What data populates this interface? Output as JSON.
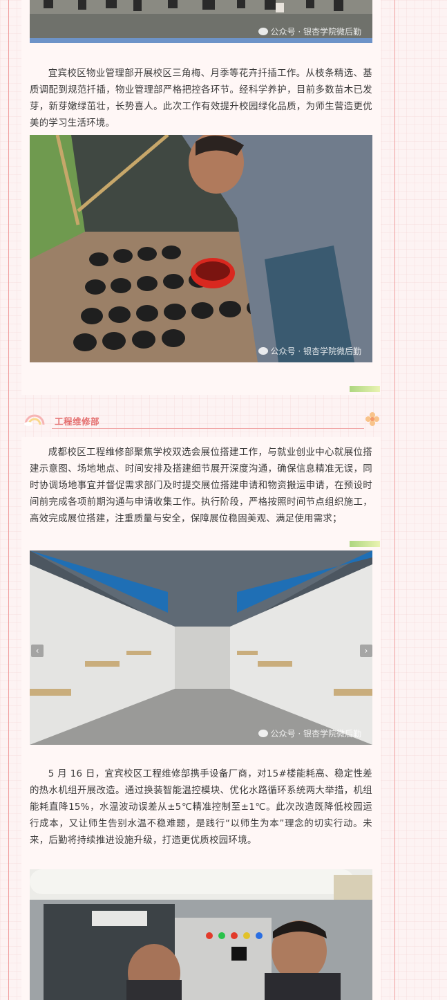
{
  "watermark": "公众号 · 银杏学院微后勤",
  "section1": {
    "paragraph": "宜宾校区物业管理部开展校区三角梅、月季等花卉扦插工作。从枝条精选、基质调配到规范扦插，物业管理部严格把控各环节。经科学养护，目前多数苗木已发芽，新芽嫩绿茁壮，长势喜人。此次工作有效提升校园绿化品质，为师生营造更优美的学习生活环境。"
  },
  "section2": {
    "title": "工程维修部",
    "paragraph1": "成都校区工程维修部聚焦学校双选会展位搭建工作，与就业创业中心就展位搭建示意图、场地地点、时间安排及搭建细节展开深度沟通，确保信息精准无误，同时协调场地事宜并督促需求部门及时提交展位搭建申请和物资搬运申请，在预设时间前完成各项前期沟通与申请收集工作。执行阶段，严格按照时间节点组织施工，高效完成展位搭建，注重质量与安全，保障展位稳固美观、满足使用需求；",
    "paragraph2": "5 月 16 日，宜宾校区工程维修部携手设备厂商，对15#楼能耗高、稳定性差的热水机组开展改造。通过换装智能温控模块、优化水路循环系统两大举措，机组能耗直降15%，水温波动误差从±5℃精准控制至±1℃。此次改造既降低校园运行成本，又让师生告别水温不稳难题，是践行“以师生为本”理念的切实行动。未来，后勤将持续推进设施升级，打造更优质校园环境。"
  },
  "carousel": {
    "prev": "‹",
    "next": "›"
  },
  "colors": {
    "accent": "#e46e6e",
    "border": "#ef9d9d",
    "card": "#fff7f6"
  }
}
